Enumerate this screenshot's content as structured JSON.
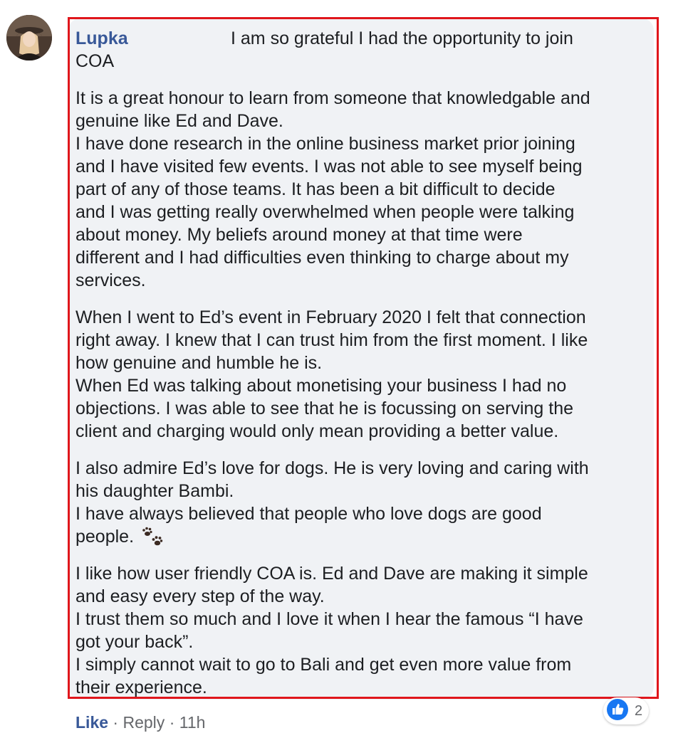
{
  "comment": {
    "author": "Lupka",
    "lines": [
      "I am so grateful I had the opportunity to join",
      "COA",
      "",
      "It is a great honour to learn from someone that knowledgable and",
      "genuine like Ed and Dave.",
      "I have done research in the online business market prior joining",
      "and I have visited few events. I was not able to see myself being",
      "part of any of those teams. It has been a bit difficult to decide",
      "and I was getting really overwhelmed when people were talking",
      "about money. My beliefs around money at that time were",
      "different and I had difficulties even thinking to charge about my",
      "services.",
      "",
      "When I went to Ed’s event in February 2020 I felt that connection",
      "right away. I knew that I can trust him from the first moment. I like",
      "how genuine and humble he is.",
      "When Ed was talking about monetising your business I had no",
      "objections. I was able to see that he is focussing on serving the",
      "client and charging would only mean providing a better value.",
      "",
      "I also admire Ed’s love for dogs. He is very loving and caring with",
      "his daughter Bambi.",
      "I have always believed that people who love dogs are good",
      "people.",
      "",
      "I like how user friendly COA is. Ed and Dave are making it simple",
      "and easy every step of the way.",
      "I trust them so much and I love it when I hear the famous “I have",
      "got your back”.",
      "I simply cannot wait to go to Bali and get even more value from",
      "their experience."
    ],
    "emoji_icon": "paw-prints-icon"
  },
  "actions": {
    "like_label": "Like",
    "separator": "·",
    "reply_label": "Reply",
    "timestamp": "11h"
  },
  "reactions": {
    "icon": "thumbs-up-icon",
    "count": "2"
  },
  "colors": {
    "author": "#385898",
    "bubble": "#f0f2f5",
    "highlight_border": "#e0161c",
    "like_badge": "#1877f2",
    "meta_text": "#65676b"
  }
}
